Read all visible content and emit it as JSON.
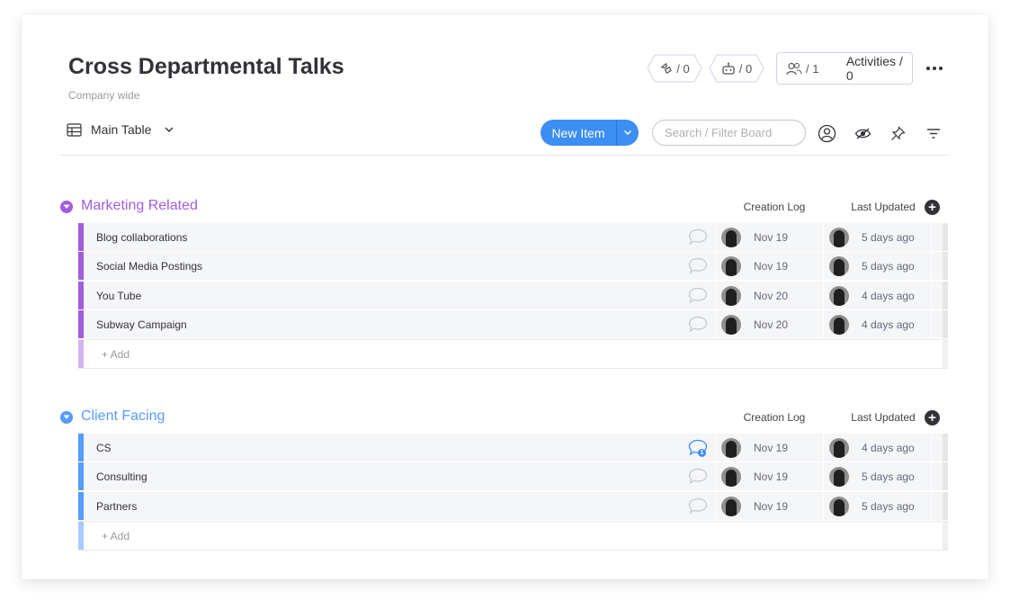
{
  "board": {
    "title": "Cross Departmental Talks",
    "subtitle": "Company wide"
  },
  "header": {
    "integrations_count": "/ 0",
    "automations_count": "/ 0",
    "members_count": "/ 1",
    "activities_label": "Activities / 0"
  },
  "toolbar": {
    "view_label": "Main Table",
    "new_item_label": "New Item",
    "search_placeholder": "Search / Filter Board"
  },
  "colors": {
    "marketing": "#a25ddc",
    "marketing_light": "#d3b3ee",
    "client": "#579bfc",
    "client_light": "#a9cbfd",
    "primary": "#3d8ef2"
  },
  "groups": [
    {
      "name": "Marketing Related",
      "col_creation": "Creation Log",
      "col_updated": "Last Updated",
      "add_label": "+ Add",
      "rows": [
        {
          "name": "Blog collaborations",
          "created": "Nov 19",
          "updated": "5 days ago"
        },
        {
          "name": "Social Media Postings",
          "created": "Nov 19",
          "updated": "5 days ago"
        },
        {
          "name": "You Tube",
          "created": "Nov 20",
          "updated": "4 days ago"
        },
        {
          "name": "Subway Campaign",
          "created": "Nov 20",
          "updated": "4 days ago"
        }
      ]
    },
    {
      "name": "Client Facing",
      "col_creation": "Creation Log",
      "col_updated": "Last Updated",
      "add_label": "+ Add",
      "rows": [
        {
          "name": "CS",
          "created": "Nov 19",
          "updated": "4 days ago",
          "updates": "1"
        },
        {
          "name": "Consulting",
          "created": "Nov 19",
          "updated": "5 days ago"
        },
        {
          "name": "Partners",
          "created": "Nov 19",
          "updated": "5 days ago"
        }
      ]
    }
  ]
}
